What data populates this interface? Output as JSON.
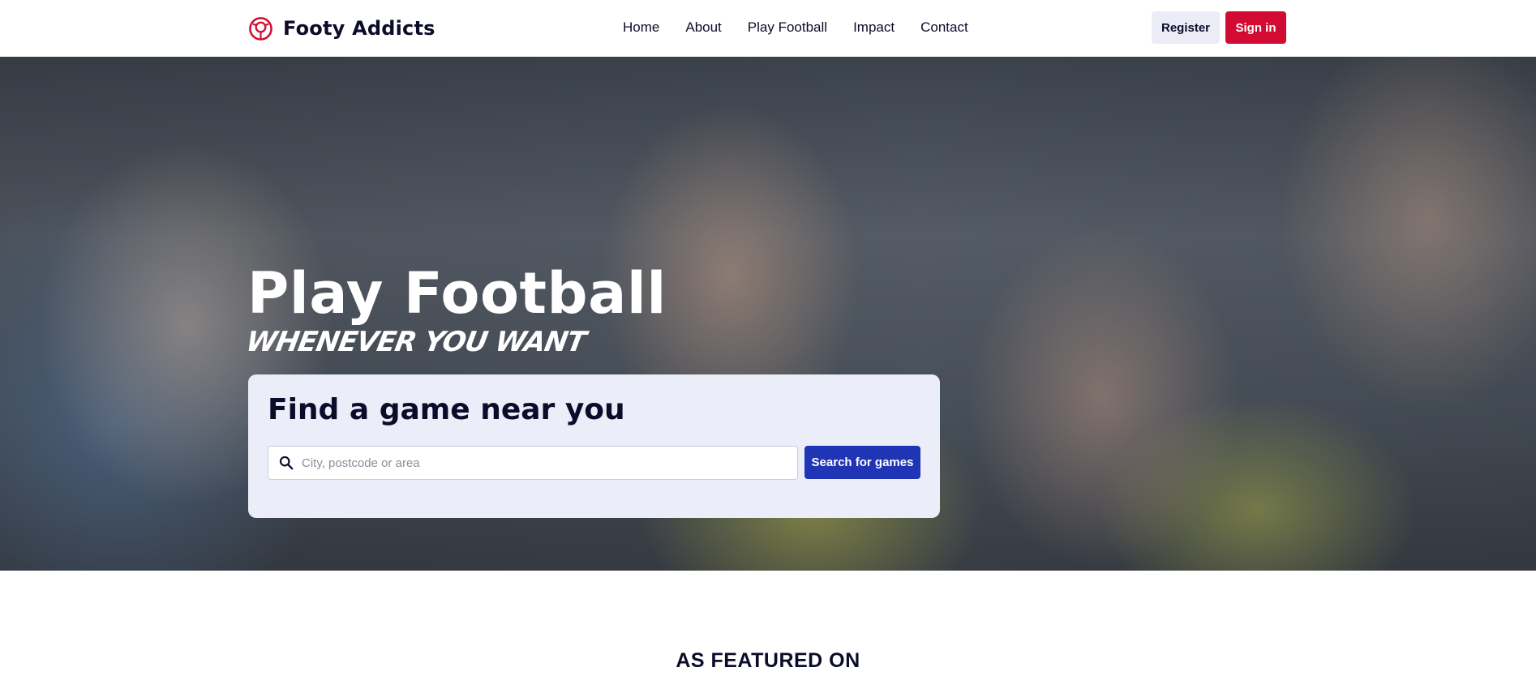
{
  "brand": {
    "name": "Footy Addicts",
    "icon": "football-ring-icon",
    "color": "#d20b32"
  },
  "nav": {
    "items": [
      {
        "label": "Home"
      },
      {
        "label": "About"
      },
      {
        "label": "Play Football"
      },
      {
        "label": "Impact"
      },
      {
        "label": "Contact"
      }
    ]
  },
  "auth": {
    "register_label": "Register",
    "signin_label": "Sign in"
  },
  "hero": {
    "title": "Play Football",
    "subtitle": "WHENEVER YOU WANT",
    "search": {
      "heading": "Find a game near you",
      "placeholder": "City, postcode or area",
      "value": "",
      "button_label": "Search for games",
      "icon": "search-icon"
    }
  },
  "featured": {
    "heading": "AS FEATURED ON"
  },
  "colors": {
    "accent": "#d20b32",
    "primary_button": "#1f35b5",
    "card_background": "#ebedf8",
    "text": "#0b0c2a"
  }
}
